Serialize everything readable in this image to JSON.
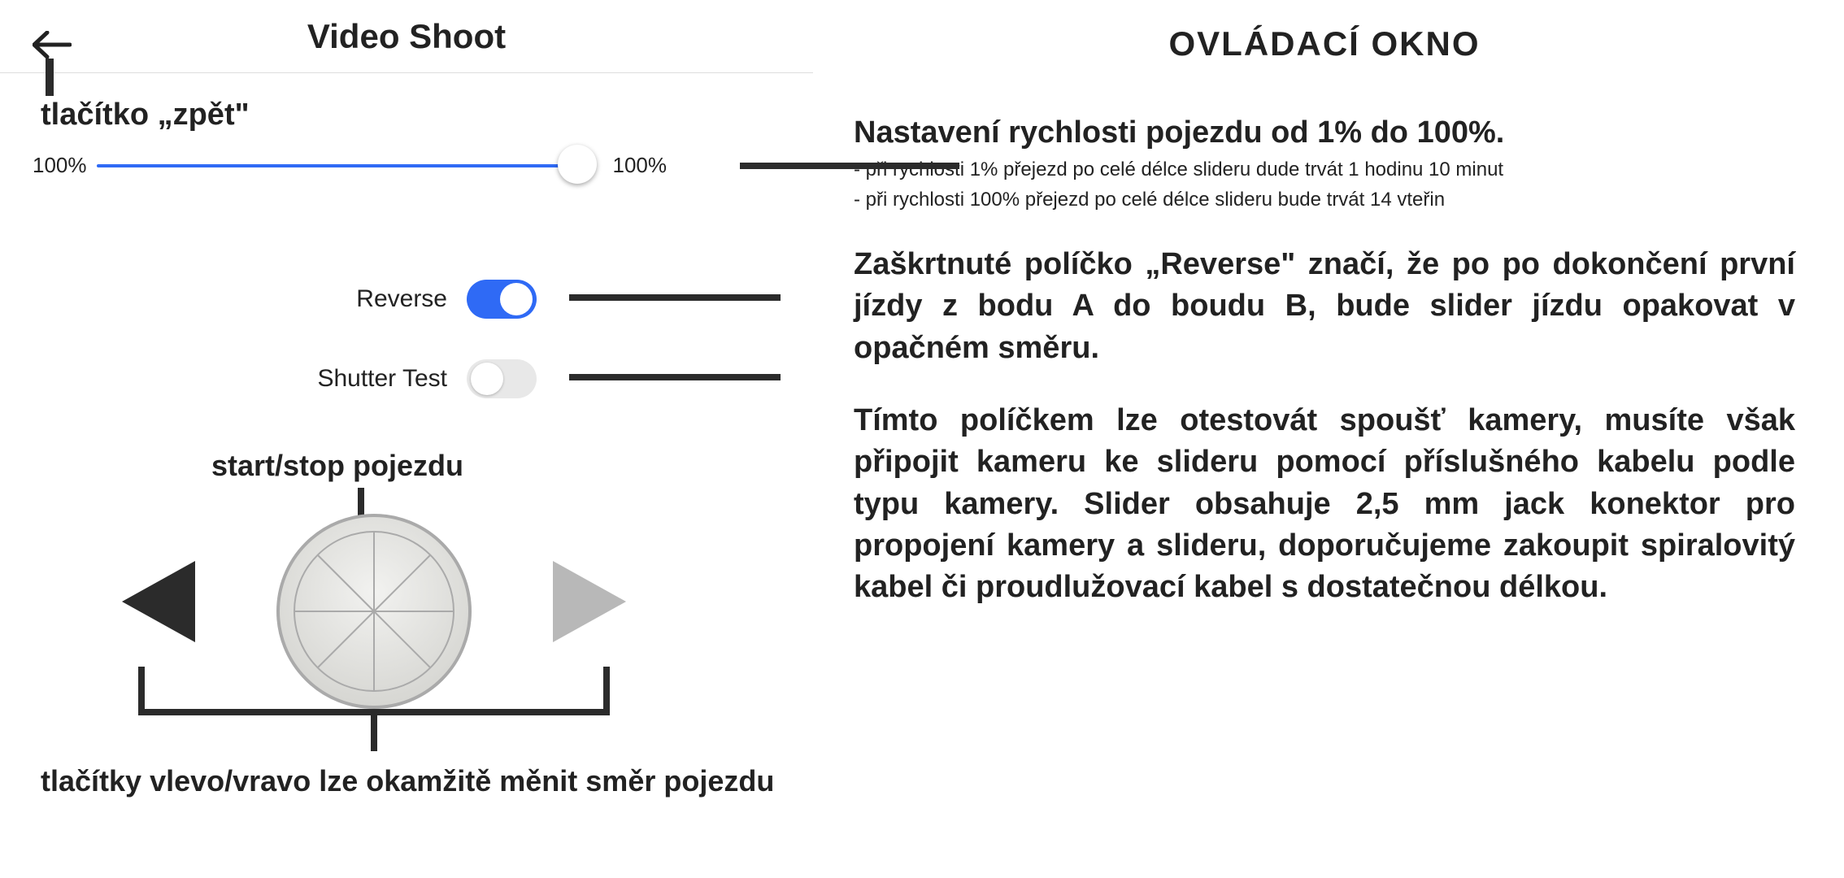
{
  "app": {
    "title": "Video Shoot",
    "back_label": "tlačítko „zpět\"",
    "slider": {
      "left_label": "100%",
      "right_label": "100%",
      "position_percent": 100
    },
    "reverse": {
      "label": "Reverse",
      "on": true
    },
    "shutter_test": {
      "label": "Shutter Test",
      "on": false
    },
    "startstop_label": "start/stop pojezdu",
    "direction_label": "tlačítky vlevo/vravo lze okamžitě měnit směr pojezdu"
  },
  "info": {
    "title": "OVLÁDACÍ OKNO",
    "speed": {
      "heading": "Nastavení rychlosti pojezdu od 1% do 100%.",
      "bullet1": "- při rychlosti 1% přejezd po celé délce slideru dude trvát 1 hodinu 10 minut",
      "bullet2": "- při rychlosti 100% přejezd po celé délce slideru bude trvát 14 vteřin"
    },
    "reverse_text": "Zaškrtnuté políčko „Reverse\" značí, že po po dokončení první jízdy z bodu A do boudu B, bude slider jízdu opakovat v opačném směru.",
    "shutter_text": "Tímto políčkem lze otestovát spoušť kamery, musíte však připojit kameru ke slideru pomocí příslušného kabelu podle typu kamery. Slider obsahuje 2,5 mm jack konektor pro propojení kamery a slideru, doporučujeme zakoupit spiralovitý kabel či proudlužovací kabel s dostatečnou délkou."
  }
}
